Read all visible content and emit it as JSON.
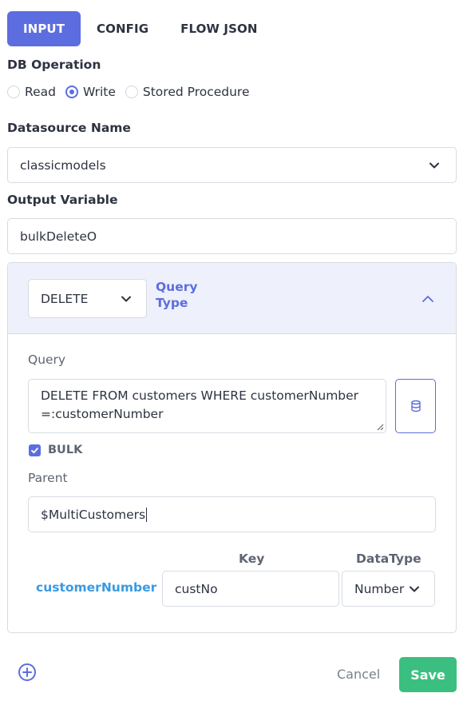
{
  "tabs": [
    {
      "label": "INPUT",
      "active": true
    },
    {
      "label": "CONFIG",
      "active": false
    },
    {
      "label": "FLOW JSON",
      "active": false
    }
  ],
  "db_operation": {
    "label": "DB Operation",
    "options": [
      "Read",
      "Write",
      "Stored Procedure"
    ],
    "selected": "Write"
  },
  "datasource": {
    "label": "Datasource Name",
    "value": "classicmodels",
    "icon": "chevron-down-icon"
  },
  "output_variable": {
    "label": "Output Variable",
    "value": "bulkDeleteO"
  },
  "query_panel": {
    "query_type_value": "DELETE",
    "query_type_label": "Query Type",
    "collapse_icon": "chevron-up-icon",
    "query_label": "Query",
    "query_value": "DELETE FROM customers WHERE customerNumber =:customerNumber",
    "db_icon": "database-icon",
    "bulk_label": "BULK",
    "bulk_checked": true,
    "parent_label": "Parent",
    "parent_value": "$MultiCustomers",
    "columns": {
      "key": "Key",
      "datatype": "DataType"
    },
    "params": [
      {
        "name": "customerNumber",
        "key": "custNo",
        "datatype": "Number"
      }
    ]
  },
  "footer": {
    "add_icon": "plus-circle-icon",
    "cancel_label": "Cancel",
    "save_label": "Save"
  },
  "colors": {
    "accent": "#5c6de0",
    "save": "#3bbf80",
    "param": "#3a9ae0"
  }
}
